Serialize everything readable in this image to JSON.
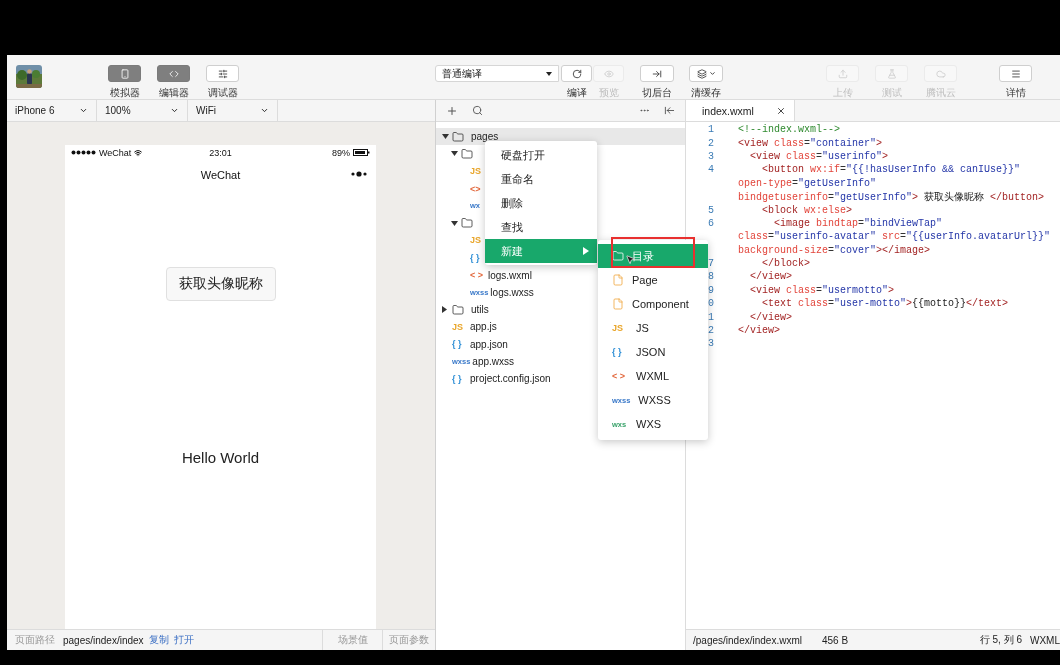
{
  "toolbar": {
    "left": [
      {
        "label": "模拟器",
        "kind": "phone",
        "selected": true
      },
      {
        "label": "编辑器",
        "kind": "code",
        "selected": true
      },
      {
        "label": "调试器",
        "kind": "debug",
        "selected": false
      }
    ],
    "compile_select": "普通编译",
    "center": [
      {
        "label": "编译",
        "kind": "refresh",
        "disabled": false,
        "has_menu": false
      },
      {
        "label": "预览",
        "kind": "eye",
        "disabled": true,
        "has_menu": false
      },
      {
        "label": "切后台",
        "kind": "switch",
        "disabled": false,
        "has_menu": false
      },
      {
        "label": "清缓存",
        "kind": "layers",
        "disabled": false,
        "has_menu": true
      }
    ],
    "right": [
      {
        "label": "上传",
        "kind": "upload",
        "disabled": true
      },
      {
        "label": "测试",
        "kind": "flask",
        "disabled": true
      },
      {
        "label": "腾讯云",
        "kind": "cloud",
        "disabled": true
      },
      {
        "label": "详情",
        "kind": "menu",
        "disabled": false
      }
    ]
  },
  "simulator": {
    "selects": [
      "iPhone 6",
      "100%",
      "WiFi"
    ],
    "status_bar": {
      "carrier": "WeChat",
      "time": "23:01",
      "battery": "89%"
    },
    "nav_title": "WeChat",
    "button": "获取头像昵称",
    "text": "Hello World",
    "footer": {
      "path_label": "页面路径",
      "path": "pages/index/index",
      "links": [
        "复制",
        "打开"
      ],
      "tabs": [
        "场景值",
        "页面参数"
      ]
    }
  },
  "file_tree": [
    {
      "kind": "folder",
      "name": "pages",
      "expanded": true,
      "selected": true,
      "children": [
        {
          "kind": "folder",
          "expanded": true,
          "selected": false,
          "children": [
            {
              "kind": "js",
              "badge": "JS",
              "selected": false
            },
            {
              "kind": "wxml",
              "badge": "<>",
              "selected": false
            },
            {
              "kind": "wxss",
              "badge": "wx",
              "selected": false
            }
          ]
        },
        {
          "kind": "folder",
          "expanded": true,
          "selected": false,
          "children": [
            {
              "kind": "js",
              "badge": "JS",
              "selected": false
            },
            {
              "kind": "json",
              "badge": "{ }",
              "selected": false
            },
            {
              "kind": "wxml",
              "badge": "< >",
              "name": "logs.wxml",
              "selected": false
            },
            {
              "kind": "wxss",
              "badge": "wxss",
              "name": "logs.wxss",
              "selected": false
            }
          ]
        }
      ]
    },
    {
      "kind": "folder",
      "name": "utils",
      "expanded": false,
      "selected": false
    },
    {
      "kind": "js",
      "badge": "JS",
      "name": "app.js",
      "selected": false
    },
    {
      "kind": "json",
      "badge": "{ }",
      "name": "app.json",
      "selected": false
    },
    {
      "kind": "wxss",
      "badge": "wxss",
      "name": "app.wxss",
      "selected": false
    },
    {
      "kind": "json",
      "badge": "{ }",
      "name": "project.config.json",
      "selected": false
    }
  ],
  "context_menu": [
    {
      "label": "硬盘打开",
      "selected": false
    },
    {
      "label": "重命名",
      "selected": false
    },
    {
      "label": "删除",
      "selected": false
    },
    {
      "label": "查找",
      "selected": false
    },
    {
      "label": "新建",
      "selected": true,
      "submenu": true
    }
  ],
  "submenu": [
    {
      "kind": "folder",
      "label": "目录",
      "selected": true
    },
    {
      "kind": "page",
      "label": "Page",
      "selected": false
    },
    {
      "kind": "component",
      "label": "Component",
      "selected": false
    },
    {
      "kind": "js",
      "badge": "JS",
      "label": "JS",
      "selected": false
    },
    {
      "kind": "json",
      "badge": "{ }",
      "label": "JSON",
      "selected": false
    },
    {
      "kind": "wxml",
      "badge": "< >",
      "label": "WXML",
      "selected": false
    },
    {
      "kind": "wxss",
      "badge": "wxss",
      "label": "WXSS",
      "selected": false
    },
    {
      "kind": "wxs",
      "badge": "wxs",
      "label": "WXS",
      "selected": false
    }
  ],
  "editor": {
    "tab": "index.wxml",
    "lines": [
      {
        "number": "1",
        "segments": [
          {
            "kind": "comment",
            "text": "<!--index.wxml-->"
          }
        ]
      },
      {
        "number": "2",
        "segments": [
          {
            "kind": "tag",
            "text": "<view"
          },
          {
            "kind": "attr",
            "text": " class"
          },
          {
            "kind": "punct",
            "text": "="
          },
          {
            "kind": "str",
            "text": "\"container\""
          },
          {
            "kind": "tag",
            "text": ">"
          }
        ]
      },
      {
        "number": "3",
        "segments": [
          {
            "kind": "tag",
            "text": "  <view"
          },
          {
            "kind": "attr",
            "text": " class"
          },
          {
            "kind": "punct",
            "text": "="
          },
          {
            "kind": "str",
            "text": "\"userinfo\""
          },
          {
            "kind": "tag",
            "text": ">"
          }
        ]
      },
      {
        "number": "4",
        "segments": [
          {
            "kind": "tag",
            "text": "    <button"
          },
          {
            "kind": "attr",
            "text": " wx:if"
          },
          {
            "kind": "punct",
            "text": "="
          },
          {
            "kind": "str",
            "text": "\"{{!hasUserInfo && canIUse}}\""
          }
        ]
      },
      {
        "segments": [
          {
            "kind": "attr",
            "text": "open-type"
          },
          {
            "kind": "punct",
            "text": "="
          },
          {
            "kind": "str",
            "text": "\"getUserInfo\""
          }
        ]
      },
      {
        "segments": [
          {
            "kind": "attr",
            "text": "bindgetuserinfo"
          },
          {
            "kind": "punct",
            "text": "="
          },
          {
            "kind": "str",
            "text": "\"getUserInfo\""
          },
          {
            "kind": "tag",
            "text": ">"
          },
          {
            "kind": "text",
            "text": " 获取头像昵称 "
          },
          {
            "kind": "tag",
            "text": "</button>"
          }
        ]
      },
      {
        "number": "5",
        "segments": [
          {
            "kind": "tag",
            "text": "    <block"
          },
          {
            "kind": "attr",
            "text": " wx:else"
          },
          {
            "kind": "tag",
            "text": ">"
          }
        ]
      },
      {
        "number": "6",
        "segments": [
          {
            "kind": "tag",
            "text": "      <image"
          },
          {
            "kind": "attr",
            "text": " bindtap"
          },
          {
            "kind": "punct",
            "text": "="
          },
          {
            "kind": "str",
            "text": "\"bindViewTap\""
          }
        ]
      },
      {
        "segments": [
          {
            "kind": "attr",
            "text": "class"
          },
          {
            "kind": "punct",
            "text": "="
          },
          {
            "kind": "str",
            "text": "\"userinfo-avatar\""
          },
          {
            "kind": "attr",
            "text": " src"
          },
          {
            "kind": "punct",
            "text": "="
          },
          {
            "kind": "str",
            "text": "\"{{userInfo.avatarUrl}}\""
          }
        ]
      },
      {
        "segments": [
          {
            "kind": "attr",
            "text": "background-size"
          },
          {
            "kind": "punct",
            "text": "="
          },
          {
            "kind": "str",
            "text": "\"cover\""
          },
          {
            "kind": "tag",
            "text": "></image>"
          }
        ]
      },
      {
        "number": "7",
        "segments": [
          {
            "kind": "tag",
            "text": "    </block>"
          }
        ]
      },
      {
        "number": "8",
        "segments": [
          {
            "kind": "tag",
            "text": "  </view>"
          }
        ]
      },
      {
        "number": "9",
        "segments": [
          {
            "kind": "tag",
            "text": "  <view"
          },
          {
            "kind": "attr",
            "text": " class"
          },
          {
            "kind": "punct",
            "text": "="
          },
          {
            "kind": "str",
            "text": "\"usermotto\""
          },
          {
            "kind": "tag",
            "text": ">"
          }
        ]
      },
      {
        "number": "0",
        "segments": [
          {
            "kind": "tag",
            "text": "    <text"
          },
          {
            "kind": "attr",
            "text": " class"
          },
          {
            "kind": "punct",
            "text": "="
          },
          {
            "kind": "str",
            "text": "\"user-motto\""
          },
          {
            "kind": "tag",
            "text": ">"
          },
          {
            "kind": "text",
            "text": "{{motto}}"
          },
          {
            "kind": "tag",
            "text": "</text>"
          }
        ]
      },
      {
        "number": "1",
        "segments": [
          {
            "kind": "tag",
            "text": "  </view>"
          }
        ]
      },
      {
        "number": "2",
        "segments": [
          {
            "kind": "tag",
            "text": "</view>"
          }
        ]
      },
      {
        "number": "3"
      }
    ],
    "footer": {
      "path": "/pages/index/index.wxml",
      "size": "456 B",
      "cursor": "行 5, 列 6",
      "language": "WXML"
    }
  }
}
